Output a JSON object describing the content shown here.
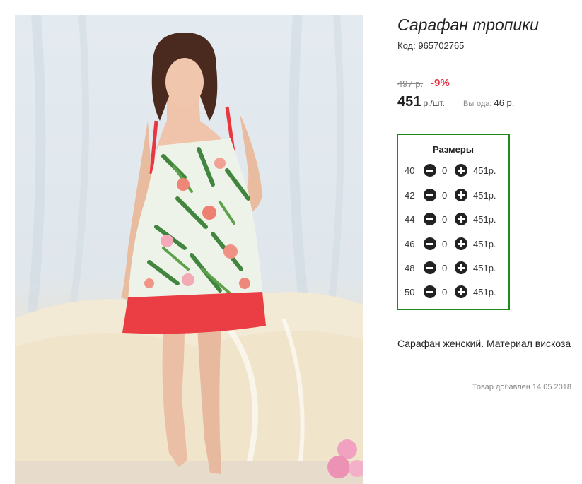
{
  "product": {
    "title": "Сарафан тропики",
    "code_label": "Код:",
    "code": "965702765",
    "old_price": "497 р.",
    "discount": "-9%",
    "price": "451",
    "price_unit": "р./шт.",
    "saving_label": "Выгода:",
    "saving_value": "46 р.",
    "description": "Сарафан женский. Материал вискоза",
    "added_label": "Товар добавлен 14.05.2018"
  },
  "sizes": {
    "heading": "Размеры",
    "rows": [
      {
        "size": "40",
        "qty": "0",
        "price": "451р."
      },
      {
        "size": "42",
        "qty": "0",
        "price": "451р."
      },
      {
        "size": "44",
        "qty": "0",
        "price": "451р."
      },
      {
        "size": "46",
        "qty": "0",
        "price": "451р."
      },
      {
        "size": "48",
        "qty": "0",
        "price": "451р."
      },
      {
        "size": "50",
        "qty": "0",
        "price": "451р."
      }
    ]
  },
  "colors": {
    "discount": "#e0343f",
    "sizes_border": "#1c8a1c"
  },
  "icons": {
    "decrease": "minus-circle-icon",
    "increase": "plus-circle-icon"
  }
}
